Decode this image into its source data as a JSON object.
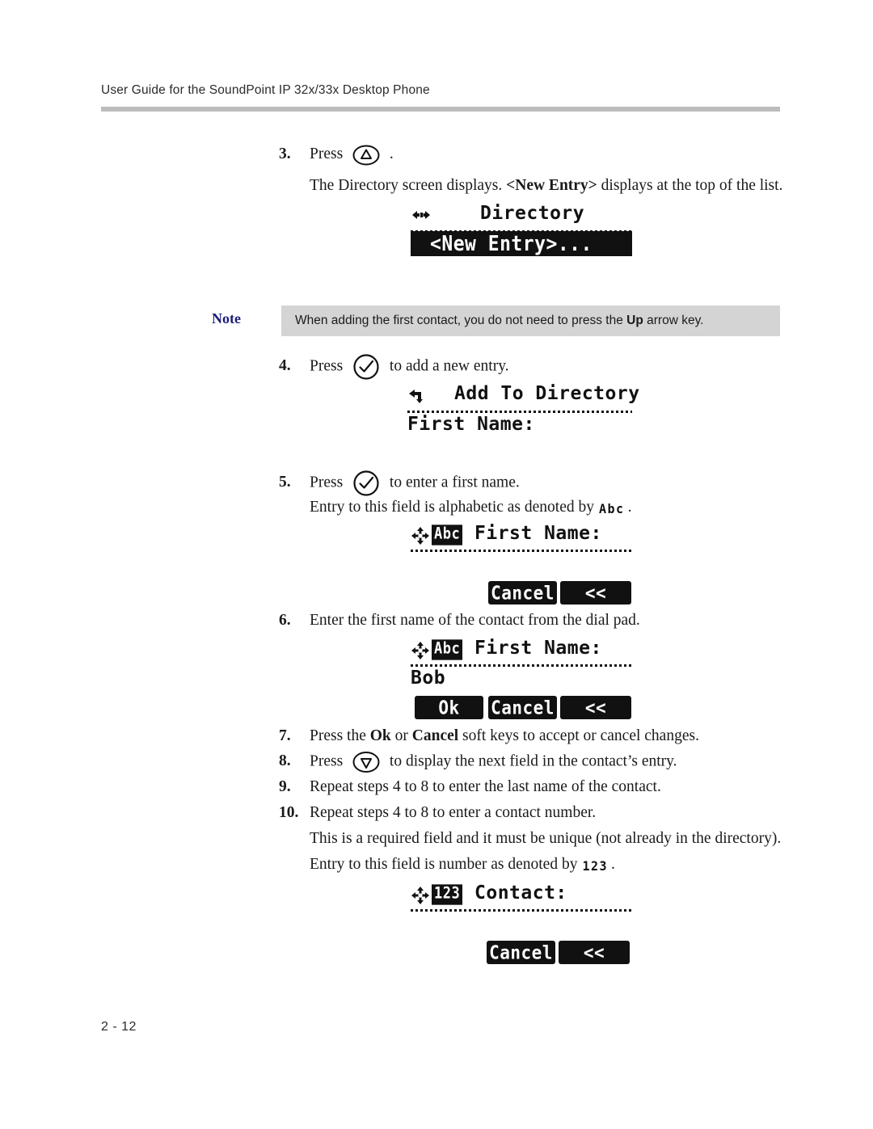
{
  "header": {
    "title": "User Guide for the SoundPoint IP 32x/33x Desktop Phone"
  },
  "footer": {
    "page_number": "2 - 12"
  },
  "steps": {
    "s3_num": "3.",
    "s3_press": "Press",
    "s3_period": ".",
    "s3_result_a": "The Directory screen displays. ",
    "s3_result_b": "<New Entry>",
    "s3_result_c": " displays at the top of the list.",
    "s4_num": "4.",
    "s4_press": "Press",
    "s4_tail": "to add a new entry.",
    "s5_num": "5.",
    "s5_press": "Press",
    "s5_tail": "to enter a first name.",
    "s5_note_a": "Entry to this field is alphabetic as denoted by",
    "s5_note_glyph": "Abc",
    "s5_note_b": ".",
    "s6_num": "6.",
    "s6_text": "Enter the first name of the contact from the dial pad.",
    "s7_num": "7.",
    "s7_a": "Press the ",
    "s7_ok": "Ok",
    "s7_b": " or ",
    "s7_cancel": "Cancel",
    "s7_c": " soft keys to accept or cancel changes.",
    "s8_num": "8.",
    "s8_press": "Press",
    "s8_tail": "to display the next field in the contact’s entry.",
    "s9_num": "9.",
    "s9_text": "Repeat steps 4 to 8 to enter the last name of the contact.",
    "s10_num": "10.",
    "s10_text": "Repeat steps 4 to 8 to enter a contact number.",
    "s10_note_1": "This is a required field and it must be unique (not already in the directory).",
    "s10_note_2a": "Entry to this field is number as denoted by",
    "s10_note_glyph": "123",
    "s10_note_2b": "."
  },
  "note": {
    "label": "Note",
    "text_a": "When adding the first contact, you do not need to press the ",
    "text_bold": "Up",
    "text_b": " arrow key."
  },
  "screens": {
    "directory": {
      "icon": "left-right-arrow-icon",
      "title": "Directory",
      "selected_item": "<New Entry>..."
    },
    "add_to_directory": {
      "icon": "back-arrow-icon",
      "title": "Add To Directory",
      "field_label": "First Name:"
    },
    "first_name_empty": {
      "icon": "edit-navigation-icon",
      "mode_badge": "Abc",
      "title": "First Name:",
      "value": "",
      "softkeys": [
        "Cancel",
        "<<"
      ]
    },
    "first_name_filled": {
      "icon": "edit-navigation-icon",
      "mode_badge": "Abc",
      "title": "First Name:",
      "value": "Bob",
      "softkeys": [
        "Ok",
        "Cancel",
        "<<"
      ]
    },
    "contact": {
      "icon": "edit-navigation-icon",
      "mode_badge": "123",
      "title": "Contact:",
      "value": "",
      "softkeys": [
        "Cancel",
        "<<"
      ]
    }
  },
  "colors": {
    "note_label": "#1d1d7a",
    "note_bg": "#d4d4d4",
    "rule": "#bcbcbc",
    "lcd_fg": "#111111"
  }
}
